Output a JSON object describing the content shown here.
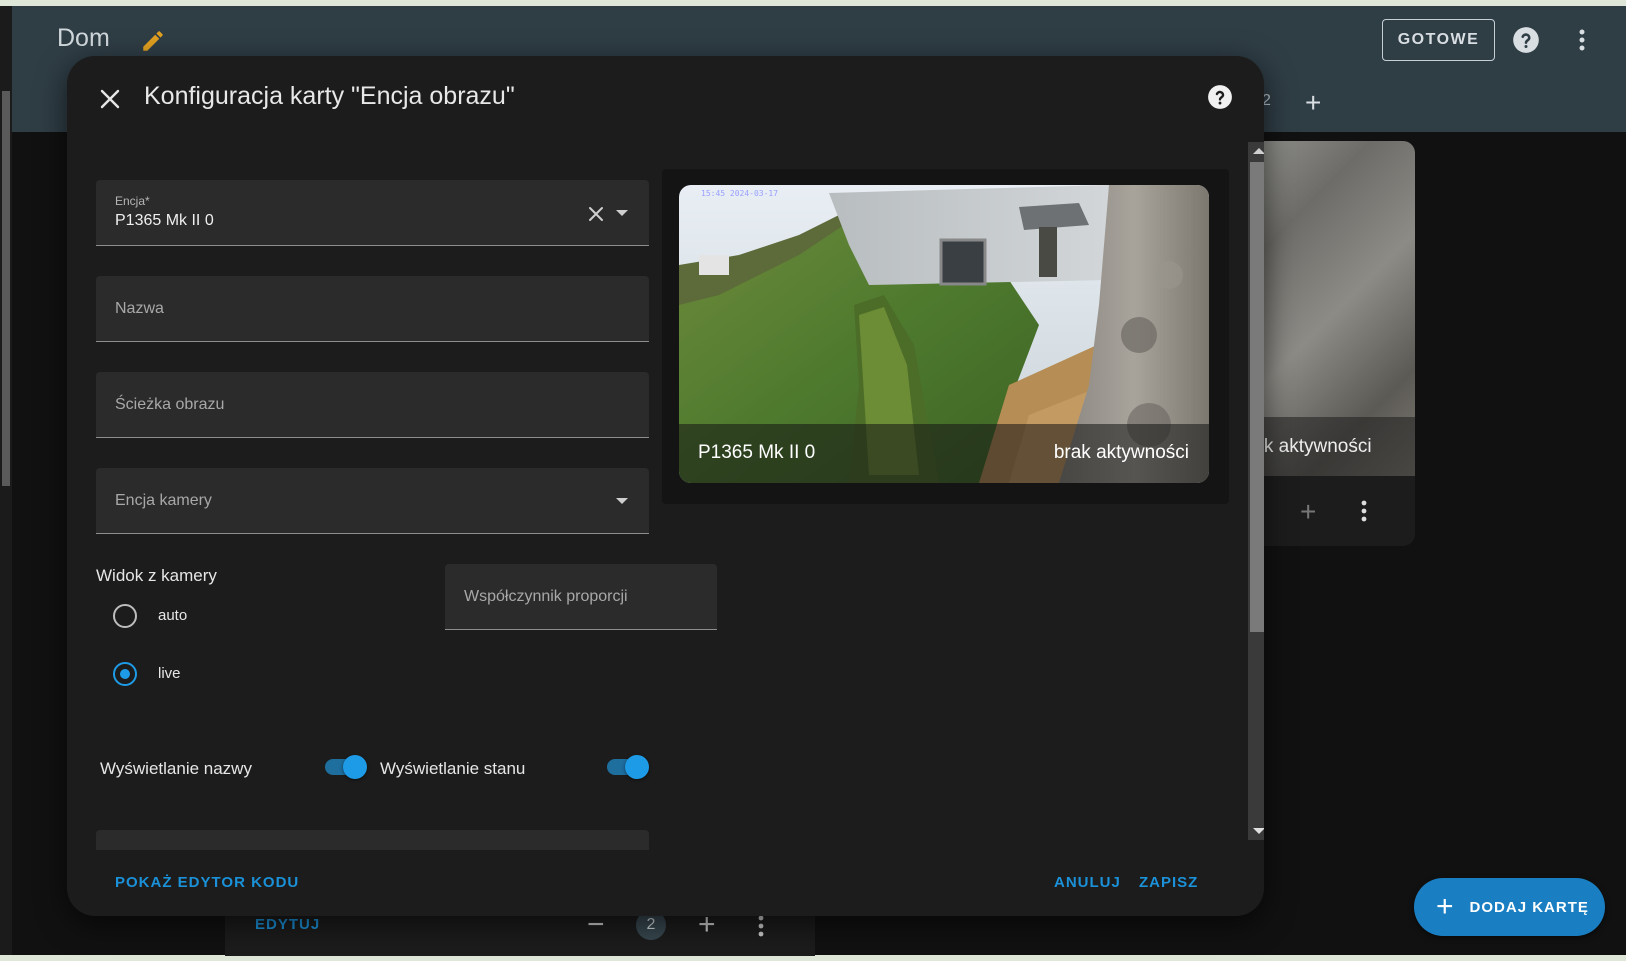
{
  "header": {
    "title": "Dom",
    "done_label": "GOTOWE",
    "tab_partial": "2"
  },
  "dialog": {
    "title": "Konfiguracja karty \"Encja obrazu\"",
    "entity_label": "Encja*",
    "entity_value": "P1365 Mk II 0",
    "name_label": "Nazwa",
    "image_path_label": "Ścieżka obrazu",
    "camera_entity_label": "Encja kamery",
    "camera_view_label": "Widok z kamery",
    "camera_view_options": [
      "auto",
      "live"
    ],
    "camera_view_selected": "live",
    "aspect_ratio_label": "Współczynnik proporcji",
    "show_name_label": "Wyświetlanie nazwy",
    "show_name_on": true,
    "show_state_label": "Wyświetlanie stanu",
    "show_state_on": true,
    "show_code_editor_label": "POKAŻ EDYTOR KODU",
    "cancel_label": "ANULUJ",
    "save_label": "ZAPISZ"
  },
  "preview": {
    "name": "P1365 Mk II 0",
    "state": "brak aktywności",
    "timestamp_overlay": "15:45 2024-03-17"
  },
  "background_card": {
    "state_partial": "rak aktywności"
  },
  "bottom_card": {
    "edit_label": "EDYTUJ",
    "count": "2"
  },
  "fab": {
    "label": "DODAJ KARTĘ"
  },
  "colors": {
    "accent": "#1a91d8",
    "header_bg": "#2f3d45",
    "dialog_bg": "#1c1c1c"
  }
}
